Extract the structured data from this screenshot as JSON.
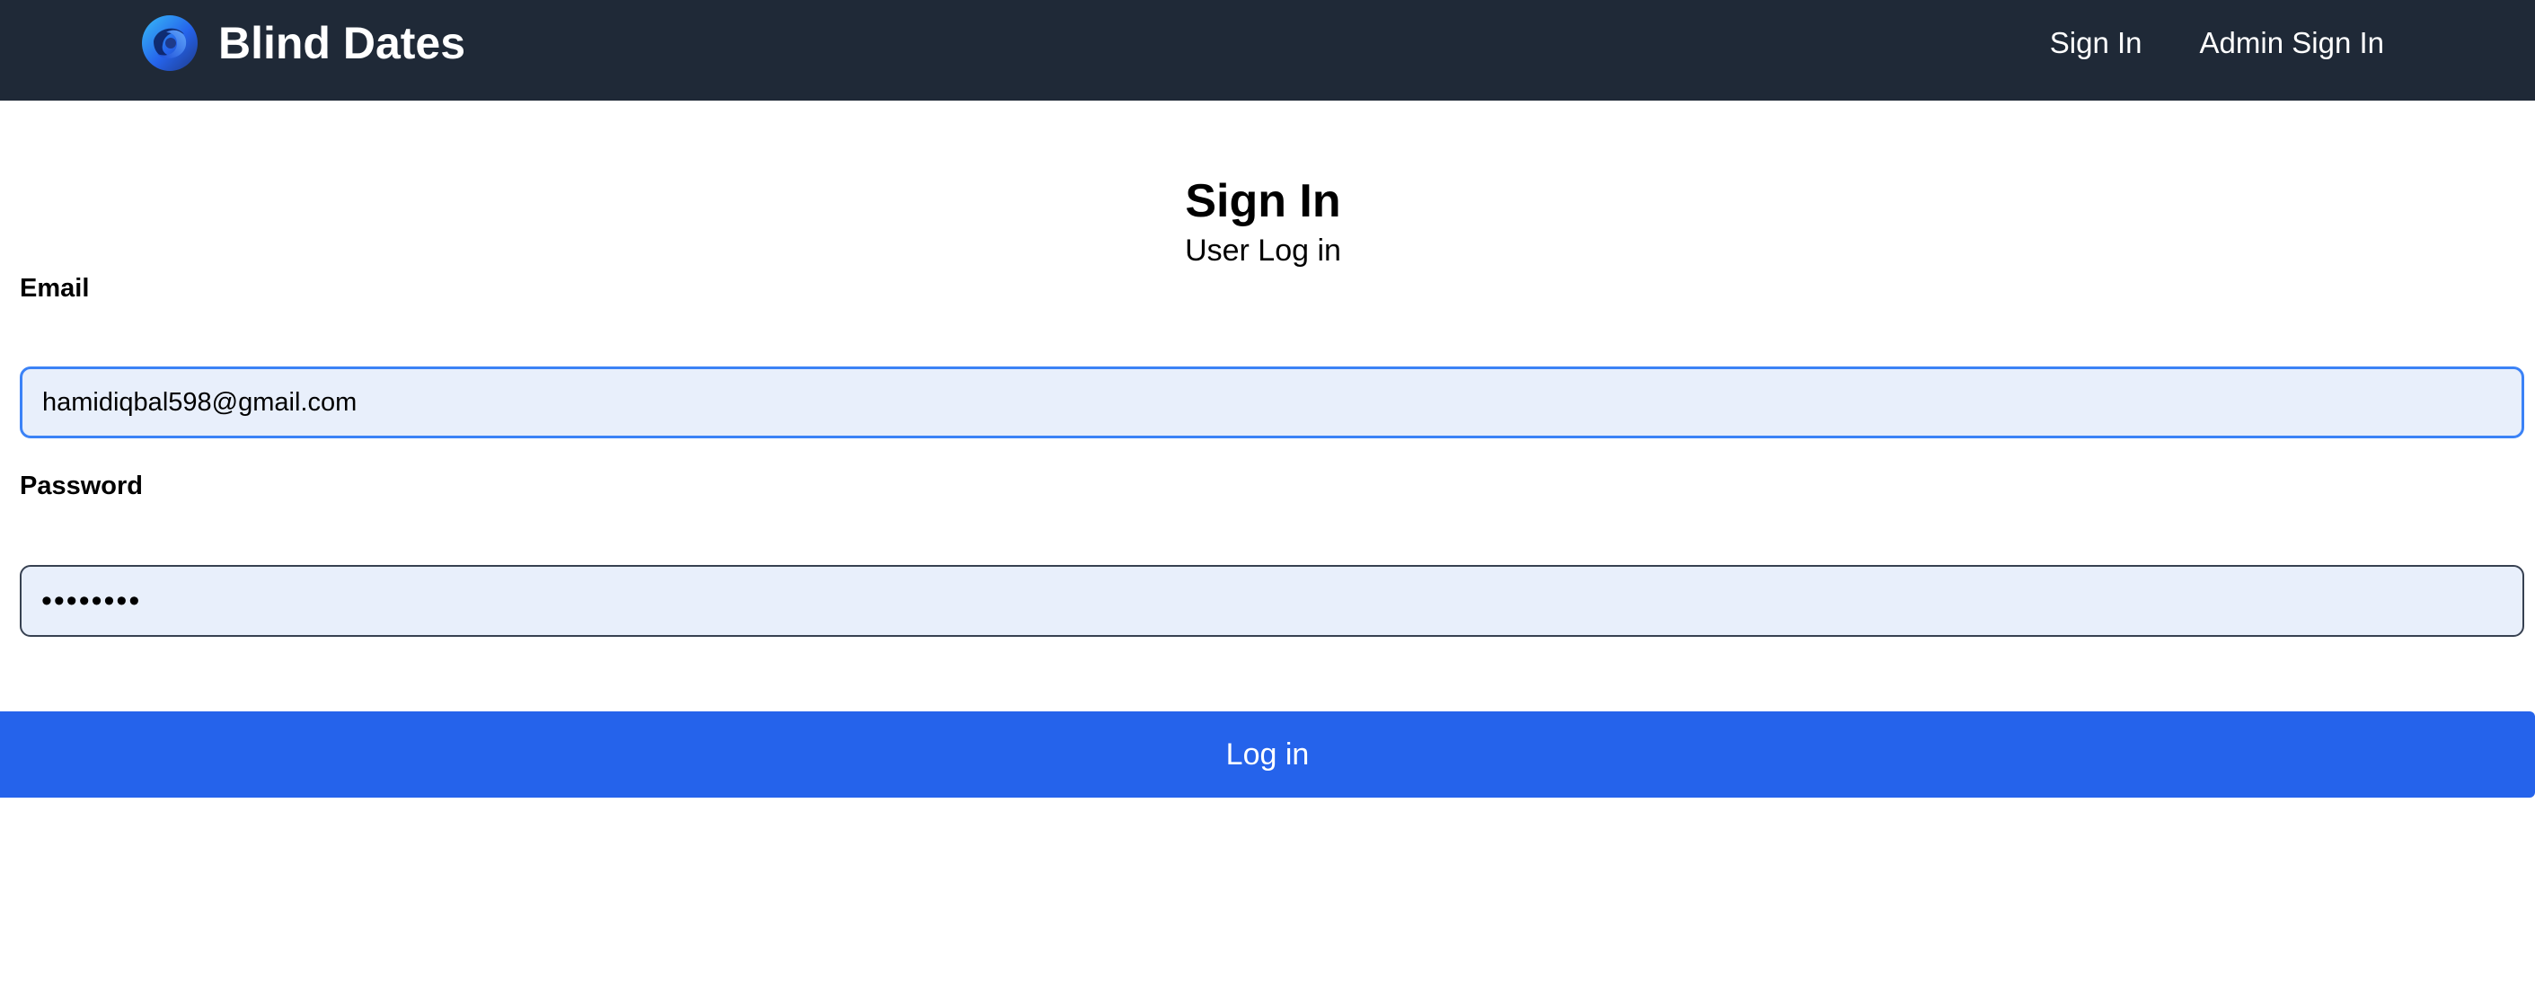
{
  "navbar": {
    "brand_name": "Blind Dates",
    "logo_icon": "blind-dates-logo-icon",
    "links": [
      {
        "label": "Sign In"
      },
      {
        "label": "Admin Sign In"
      }
    ]
  },
  "page": {
    "title": "Sign In",
    "subtitle": "User Log in"
  },
  "form": {
    "email_label": "Email",
    "email_value": "hamidiqbal598@gmail.com",
    "password_label": "Password",
    "password_value": "********",
    "submit_label": "Log in"
  },
  "colors": {
    "navbar_bg": "#1f2937",
    "primary": "#2563eb",
    "input_bg": "#e8effb",
    "focus_ring": "#3b82f6"
  }
}
